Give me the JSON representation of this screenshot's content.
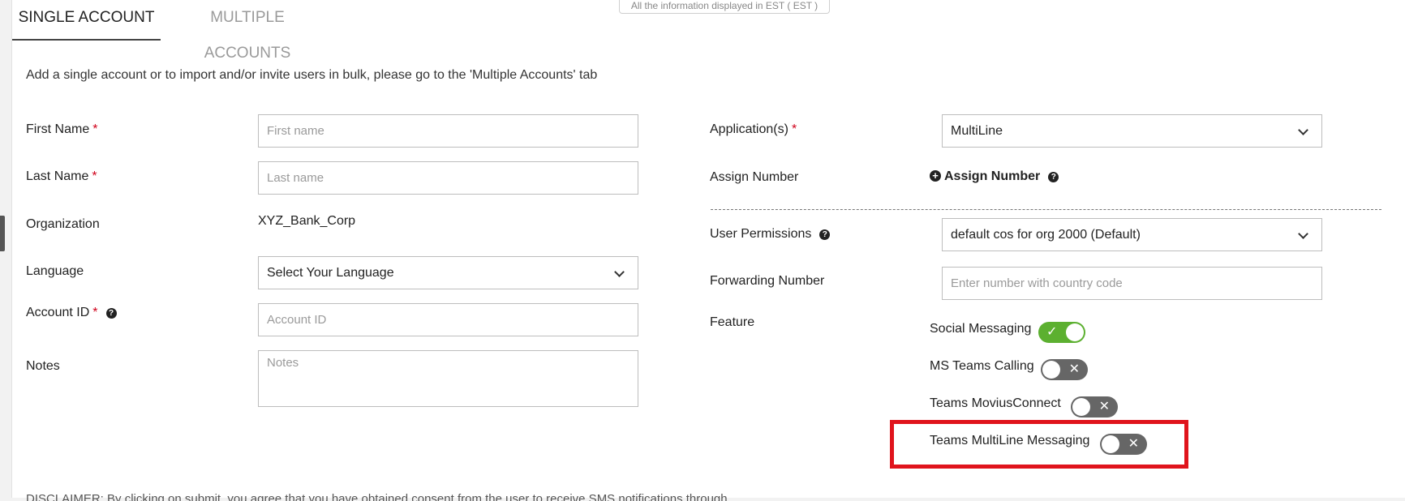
{
  "tabs": [
    {
      "label": "SINGLE ACCOUNT",
      "active": true
    },
    {
      "label": "MULTIPLE ACCOUNTS",
      "active": false
    }
  ],
  "timezone_notice": "All the information displayed in EST ( EST )",
  "intro_text": "Add a single account or to import and/or invite users in bulk, please go to the 'Multiple Accounts' tab",
  "required_marker": "*",
  "left_form": {
    "first_name": {
      "label": "First Name",
      "placeholder": "First name"
    },
    "last_name": {
      "label": "Last Name",
      "placeholder": "Last name"
    },
    "organization": {
      "label": "Organization",
      "value": "XYZ_Bank_Corp"
    },
    "language": {
      "label": "Language",
      "selected": "Select Your Language"
    },
    "account_id": {
      "label": "Account ID",
      "placeholder": "Account ID"
    },
    "notes": {
      "label": "Notes",
      "placeholder": "Notes"
    }
  },
  "right_form": {
    "applications": {
      "label": "Application(s)",
      "selected": "MultiLine"
    },
    "assign_number": {
      "label": "Assign Number",
      "link_label": "Assign Number"
    },
    "user_permissions": {
      "label": "User Permissions",
      "selected": "default cos for org 2000 (Default)"
    },
    "forwarding_number": {
      "label": "Forwarding Number",
      "placeholder": "Enter number with country code"
    },
    "feature": {
      "label": "Feature",
      "toggles": [
        {
          "label": "Social Messaging",
          "state": "on"
        },
        {
          "label": "MS Teams Calling",
          "state": "off"
        },
        {
          "label": "Teams MoviusConnect",
          "state": "off"
        },
        {
          "label": "Teams MultiLine Messaging",
          "state": "off"
        }
      ]
    }
  },
  "icons": {
    "help": "question-circle-icon",
    "assign": "plus-circle-icon",
    "select": "chevron-down-icon",
    "toggle_on": "check-icon",
    "toggle_off": "x-icon"
  },
  "glyphs": {
    "help": "?",
    "plus": "+",
    "check": "✓",
    "cross": "✕"
  },
  "disclaimer": "DISCLAIMER: By clicking on submit, you agree that you have obtained consent from the user to receive SMS notifications through",
  "colors": {
    "toggle_on": "#5cb030",
    "toggle_off": "#666666",
    "highlight": "#e0141c",
    "required": "#d0021b"
  }
}
